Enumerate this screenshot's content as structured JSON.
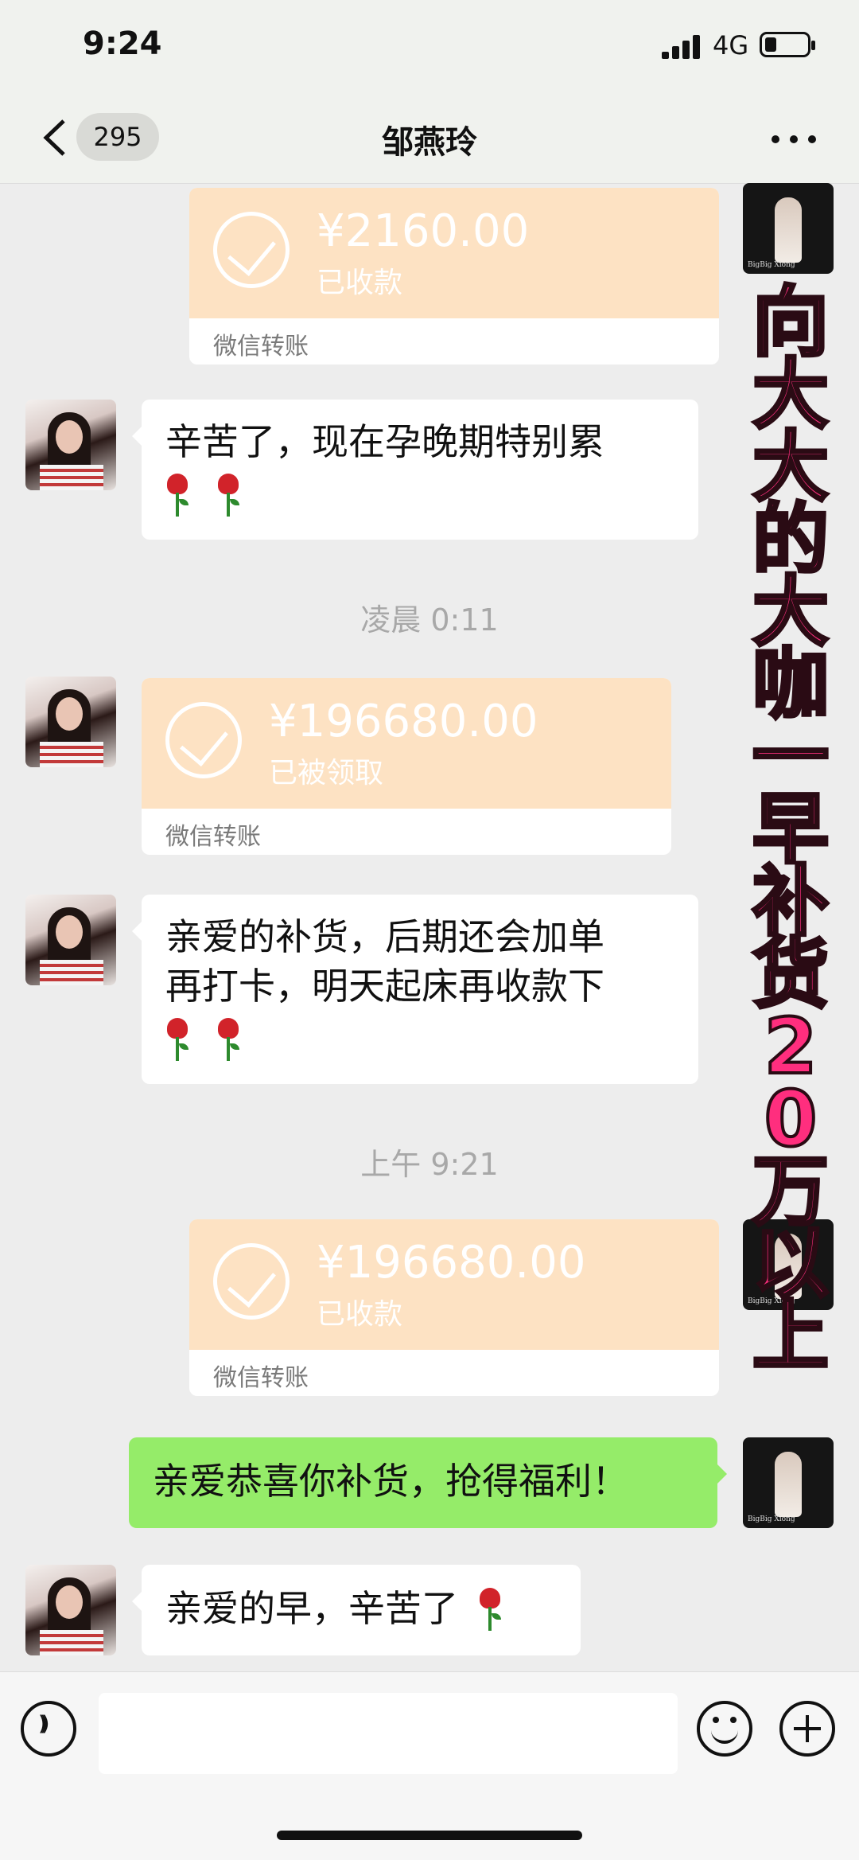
{
  "status": {
    "time": "9:24",
    "network": "4G"
  },
  "nav": {
    "unread": "295",
    "title": "邹燕玲"
  },
  "messages": {
    "t1": {
      "amount": "¥2160.00",
      "status": "已收款",
      "label": "微信转账"
    },
    "m1": {
      "line1": "辛苦了，现在孕晚期特别累"
    },
    "ts1": "凌晨 0:11",
    "t2": {
      "amount": "¥196680.00",
      "status": "已被领取",
      "label": "微信转账"
    },
    "m2": {
      "line1": "亲爱的补货，后期还会加单",
      "line2": "再打卡，明天起床再收款下"
    },
    "ts2": "上午 9:21",
    "t3": {
      "amount": "¥196680.00",
      "status": "已收款",
      "label": "微信转账"
    },
    "m3": {
      "text": "亲爱恭喜你补货，抢得福利！"
    },
    "m4": {
      "text": "亲爱的早，辛苦了"
    }
  },
  "overlay": "向大大的大咖一早补货20万以上",
  "avatar_lady_caption": "BigBig Xiong",
  "icons": [
    "back-icon",
    "more-icon",
    "voice-icon",
    "emoji-icon",
    "plus-icon",
    "check-icon",
    "rose-icon"
  ]
}
